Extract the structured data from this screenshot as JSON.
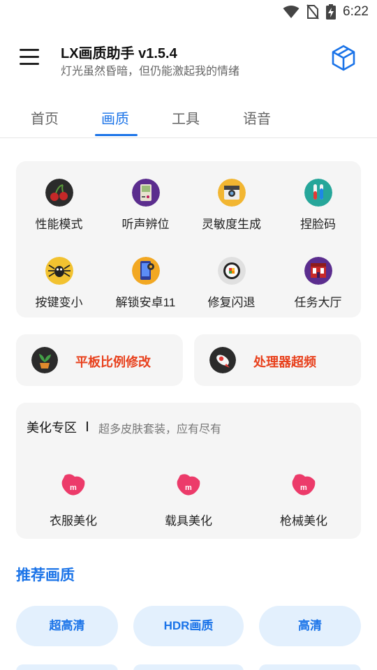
{
  "status_bar": {
    "time": "6:22"
  },
  "app_bar": {
    "title": "LX画质助手 v1.5.4",
    "subtitle": "灯光虽然昏暗，但仍能激起我的情绪"
  },
  "tabs": [
    {
      "label": "首页",
      "active": false
    },
    {
      "label": "画质",
      "active": true
    },
    {
      "label": "工具",
      "active": false
    },
    {
      "label": "语音",
      "active": false
    }
  ],
  "features": [
    {
      "label": "性能模式",
      "icon": "cherry-icon"
    },
    {
      "label": "听声辨位",
      "icon": "gameboy-icon"
    },
    {
      "label": "灵敏度生成",
      "icon": "camera-icon"
    },
    {
      "label": "捏脸码",
      "icon": "test-tubes-icon"
    },
    {
      "label": "按键变小",
      "icon": "spider-icon"
    },
    {
      "label": "解锁安卓11",
      "icon": "phone-settings-icon"
    },
    {
      "label": "修复闪退",
      "icon": "sushi-icon"
    },
    {
      "label": "任务大厅",
      "icon": "building-icon"
    }
  ],
  "quick_actions": [
    {
      "label": "平板比例修改",
      "icon": "plant-icon"
    },
    {
      "label": "处理器超频",
      "icon": "rocket-icon"
    }
  ],
  "beauty": {
    "title": "美化专区",
    "subtitle": "超多皮肤套装，应有尽有",
    "items": [
      {
        "label": "衣服美化",
        "icon": "brand-m-icon"
      },
      {
        "label": "载具美化",
        "icon": "brand-m-icon"
      },
      {
        "label": "枪械美化",
        "icon": "brand-m-icon"
      }
    ]
  },
  "recommend": {
    "title": "推荐画质",
    "options": [
      "超高清",
      "HDR画质",
      "高清"
    ]
  },
  "colors": {
    "accent": "#1a73e8",
    "action_text": "#e8401c",
    "card_bg": "#f5f5f5",
    "pill_bg": "#e3f0fd"
  }
}
